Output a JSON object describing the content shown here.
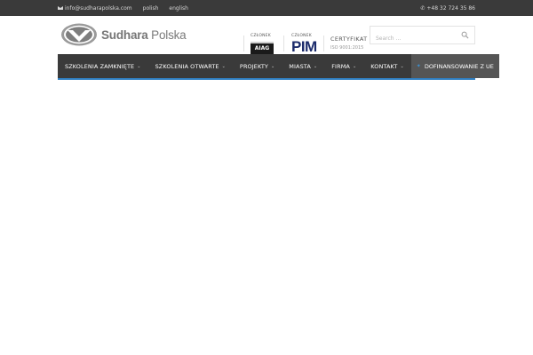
{
  "topbar": {
    "email": "info@sudharapolska.com",
    "languages": [
      "polish",
      "english"
    ],
    "phone": "+48 32 724 35 86"
  },
  "logo": {
    "brand_bold": "Sudhara",
    "brand_rest": " Polska"
  },
  "partners": {
    "aiag": {
      "caption": "CZŁONEK",
      "badge": "AIAG"
    },
    "pim": {
      "caption": "CZŁONEK",
      "badge": "PIM"
    },
    "cert": {
      "caption": "CERTYFIKAT",
      "subcaption": "ISO 9001:2015"
    }
  },
  "search": {
    "placeholder": "Search ..."
  },
  "nav": {
    "items": [
      {
        "label": "SZKOLENIA ZAMKNIĘTE"
      },
      {
        "label": "SZKOLENIA OTWARTE"
      },
      {
        "label": "PROJEKTY"
      },
      {
        "label": "MIASTA"
      },
      {
        "label": "FIRMA"
      },
      {
        "label": "KONTAKT"
      }
    ],
    "ue_label": "DOFINANSOWANIE Z UE"
  },
  "colors": {
    "topbar_bg": "#3a3a3a",
    "nav_bg": "#3a3a3a",
    "accent": "#2f7fc2",
    "ue_bg": "#555555"
  }
}
